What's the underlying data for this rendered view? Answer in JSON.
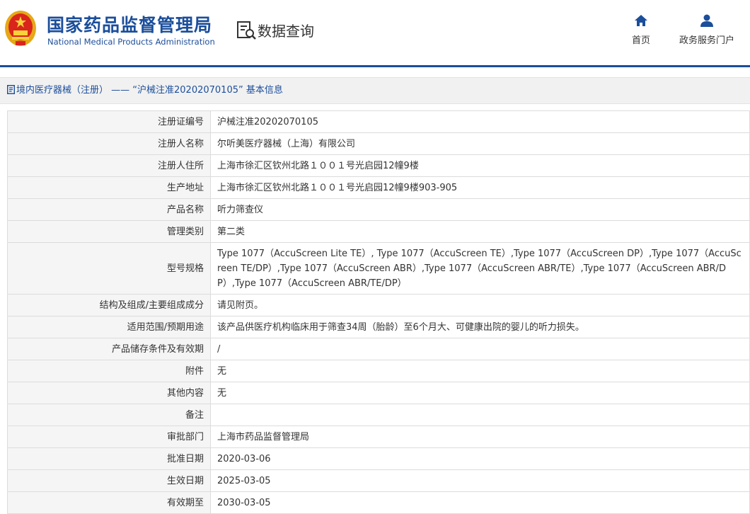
{
  "header": {
    "org_name_cn": "国家药品监督管理局",
    "org_name_en": "National Medical Products Administration",
    "section_title": "数据查询",
    "nav": [
      {
        "label": "首页",
        "icon": "home-icon"
      },
      {
        "label": "政务服务门户",
        "icon": "user-icon"
      }
    ]
  },
  "colors": {
    "brand_blue": "#1b4e9b",
    "label_bg": "#f5f5f5",
    "crumb_bg": "#f1f1f1"
  },
  "breadcrumb": {
    "icon": "document-icon",
    "category": "境内医疗器械（注册）",
    "separator": " —— ",
    "record": "“沪械注准20202070105”",
    "suffix": " 基本信息"
  },
  "details": [
    {
      "label": "注册证编号",
      "value": "沪械注准20202070105"
    },
    {
      "label": "注册人名称",
      "value": "尔听美医疗器械（上海）有限公司"
    },
    {
      "label": "注册人住所",
      "value": "上海市徐汇区钦州北路１００１号光启园12幢9楼"
    },
    {
      "label": "生产地址",
      "value": "上海市徐汇区钦州北路１００１号光启园12幢9楼903-905"
    },
    {
      "label": "产品名称",
      "value": "听力筛查仪"
    },
    {
      "label": "管理类别",
      "value": "第二类"
    },
    {
      "label": "型号规格",
      "value": "Type 1077（AccuScreen Lite TE）, Type 1077（AccuScreen TE）,Type 1077（AccuScreen DP）,Type 1077（AccuScreen TE/DP）,Type 1077（AccuScreen ABR）,Type 1077（AccuScreen ABR/TE）,Type 1077（AccuScreen ABR/DP）,Type 1077（AccuScreen ABR/TE/DP）"
    },
    {
      "label": "结构及组成/主要组成成分",
      "value": "请见附页。"
    },
    {
      "label": "适用范围/预期用途",
      "value": "该产品供医疗机构临床用于筛查34周（胎龄）至6个月大、可健康出院的婴儿的听力损失。"
    },
    {
      "label": "产品储存条件及有效期",
      "value": "/"
    },
    {
      "label": "附件",
      "value": "无"
    },
    {
      "label": "其他内容",
      "value": "无"
    },
    {
      "label": "备注",
      "value": ""
    },
    {
      "label": "审批部门",
      "value": "上海市药品监督管理局"
    },
    {
      "label": "批准日期",
      "value": "2020-03-06"
    },
    {
      "label": "生效日期",
      "value": "2025-03-05"
    },
    {
      "label": "有效期至",
      "value": "2030-03-05"
    }
  ]
}
